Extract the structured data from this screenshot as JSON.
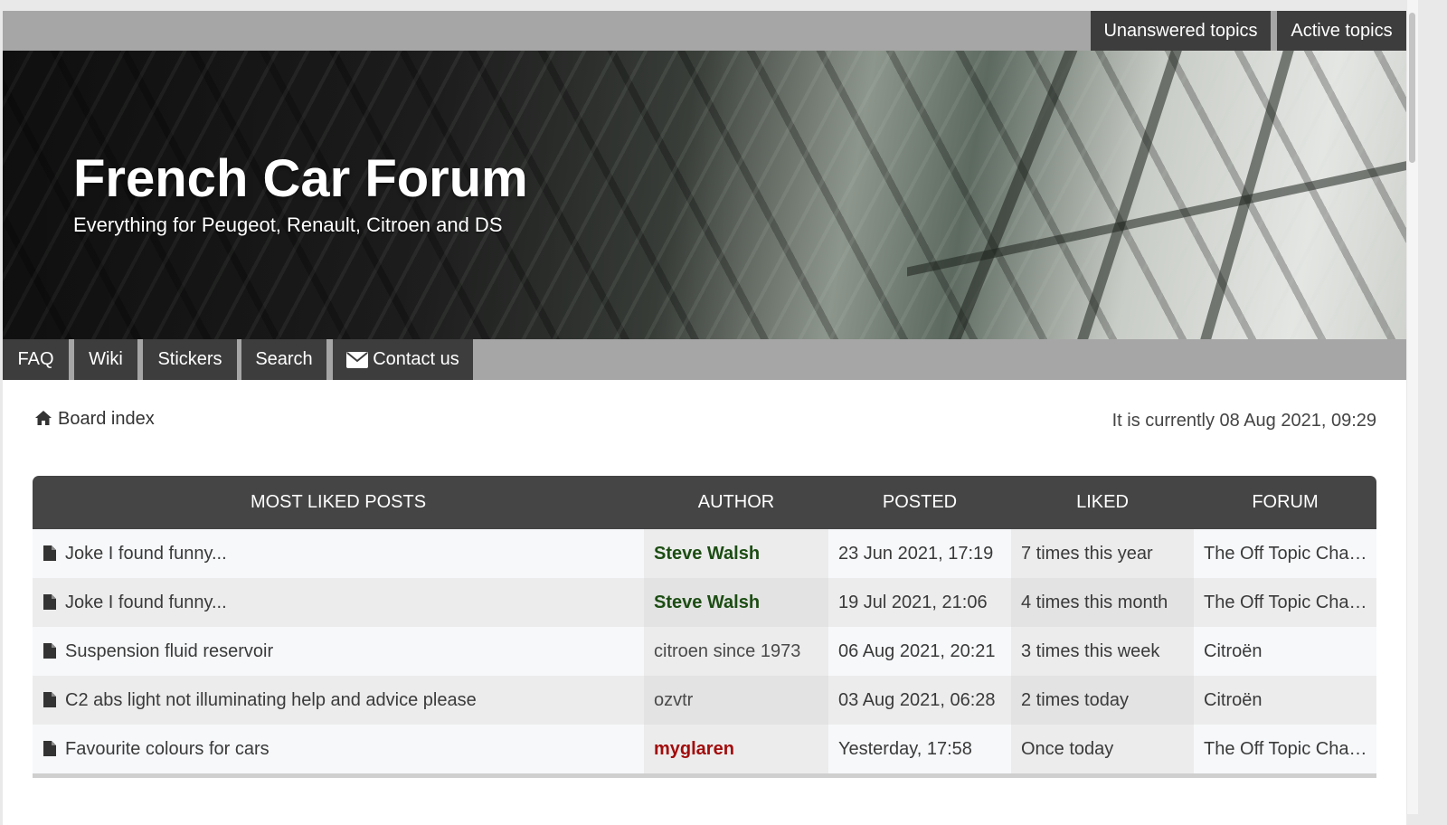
{
  "quick_links": {
    "unanswered": "Unanswered topics",
    "active": "Active topics"
  },
  "header": {
    "title": "French Car Forum",
    "description": "Everything for Peugeot, Renault, Citroen and DS"
  },
  "nav": {
    "faq": "FAQ",
    "wiki": "Wiki",
    "stickers": "Stickers",
    "search": "Search",
    "contact": "Contact us"
  },
  "breadcrumb": {
    "board_index": "Board index",
    "current_time": "It is currently 08 Aug 2021, 09:29"
  },
  "table": {
    "headers": {
      "title": "MOST LIKED POSTS",
      "author": "AUTHOR",
      "posted": "POSTED",
      "liked": "LIKED",
      "forum": "FORUM"
    },
    "rows": [
      {
        "title": "Joke I found funny...",
        "author": "Steve Walsh",
        "author_style": "green",
        "posted": "23 Jun 2021, 17:19",
        "liked": "7 times this year",
        "forum": "The Off Topic Cha…"
      },
      {
        "title": "Joke I found funny...",
        "author": "Steve Walsh",
        "author_style": "green",
        "posted": "19 Jul 2021, 21:06",
        "liked": "4 times this month",
        "forum": "The Off Topic Cha…"
      },
      {
        "title": "Suspension fluid reservoir",
        "author": "citroen since 1973",
        "author_style": "plain",
        "posted": "06 Aug 2021, 20:21",
        "liked": "3 times this week",
        "forum": "Citroën"
      },
      {
        "title": "C2 abs light not illuminating help and advice please",
        "author": "ozvtr",
        "author_style": "plain",
        "posted": "03 Aug 2021, 06:28",
        "liked": "2 times today",
        "forum": "Citroën"
      },
      {
        "title": "Favourite colours for cars",
        "author": "myglaren",
        "author_style": "red",
        "posted": "Yesterday, 17:58",
        "liked": "Once today",
        "forum": "The Off Topic Cha…"
      }
    ]
  },
  "colors": {
    "author_green": "#1c4d13",
    "author_red": "#a20c0c",
    "nav_bg": "#a6a6a6",
    "button_bg": "#3d3d3d",
    "table_header_bg": "#454545"
  },
  "icons": {
    "contact": "envelope-icon",
    "board_index": "home-icon",
    "topic": "document-icon"
  }
}
